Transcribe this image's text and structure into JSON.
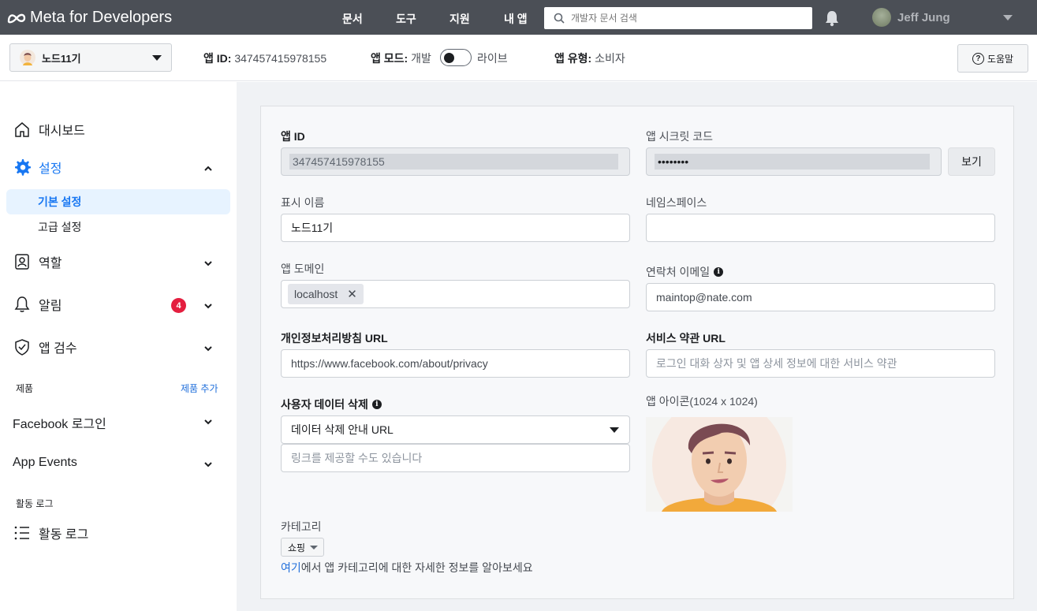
{
  "topbar": {
    "brand": "Meta for Developers",
    "nav": [
      "문서",
      "도구",
      "지원",
      "내 앱"
    ],
    "search_placeholder": "개발자 문서 검색",
    "user_name": "Jeff Jung"
  },
  "subbar": {
    "app_name": "노드11기",
    "app_id_label": "앱 ID:",
    "app_id_value": "347457415978155",
    "mode_label": "앱 모드:",
    "mode_dev": "개발",
    "mode_live": "라이브",
    "type_label": "앱 유형:",
    "type_value": "소비자",
    "help_label": "도움말"
  },
  "sidebar": {
    "dashboard": "대시보드",
    "settings": "설정",
    "basic_settings": "기본 설정",
    "advanced_settings": "고급 설정",
    "roles": "역할",
    "alerts": "알림",
    "alerts_count": "4",
    "app_review": "앱 검수",
    "products_label": "제품",
    "add_product": "제품 추가",
    "facebook_login": "Facebook 로그인",
    "app_events": "App Events",
    "activity_log_section": "활동 로그",
    "activity_log": "활동 로그"
  },
  "form": {
    "app_id_label": "앱 ID",
    "app_id_value": "347457415978155",
    "app_secret_label": "앱 시크릿 코드",
    "app_secret_value": "••••••••",
    "show_button": "보기",
    "display_name_label": "표시 이름",
    "display_name_value": "노드11기",
    "namespace_label": "네임스페이스",
    "namespace_value": "",
    "app_domain_label": "앱 도메인",
    "app_domain_tag": "localhost",
    "contact_email_label": "연락처 이메일",
    "contact_email_value": "maintop@nate.com",
    "privacy_url_label": "개인정보처리방침 URL",
    "privacy_url_value": "https://www.facebook.com/about/privacy",
    "tos_url_label": "서비스 약관 URL",
    "tos_url_placeholder": "로그인 대화 상자 및 앱 상세 정보에 대한 서비스 약관",
    "user_data_deletion_label": "사용자 데이터 삭제",
    "user_data_deletion_select": "데이터 삭제 안내 URL",
    "user_data_deletion_placeholder": "링크를 제공할 수도 있습니다",
    "app_icon_label": "앱 아이콘(1024 x 1024)",
    "category_label": "카테고리",
    "category_value": "쇼핑",
    "category_help_link": "여기",
    "category_help_text": "에서 앱 카테고리에 대한 자세한 정보를 알아보세요"
  },
  "colors": {
    "topbar": "#4b4f56",
    "accent": "#1877f2",
    "badge": "#e41e3f"
  }
}
